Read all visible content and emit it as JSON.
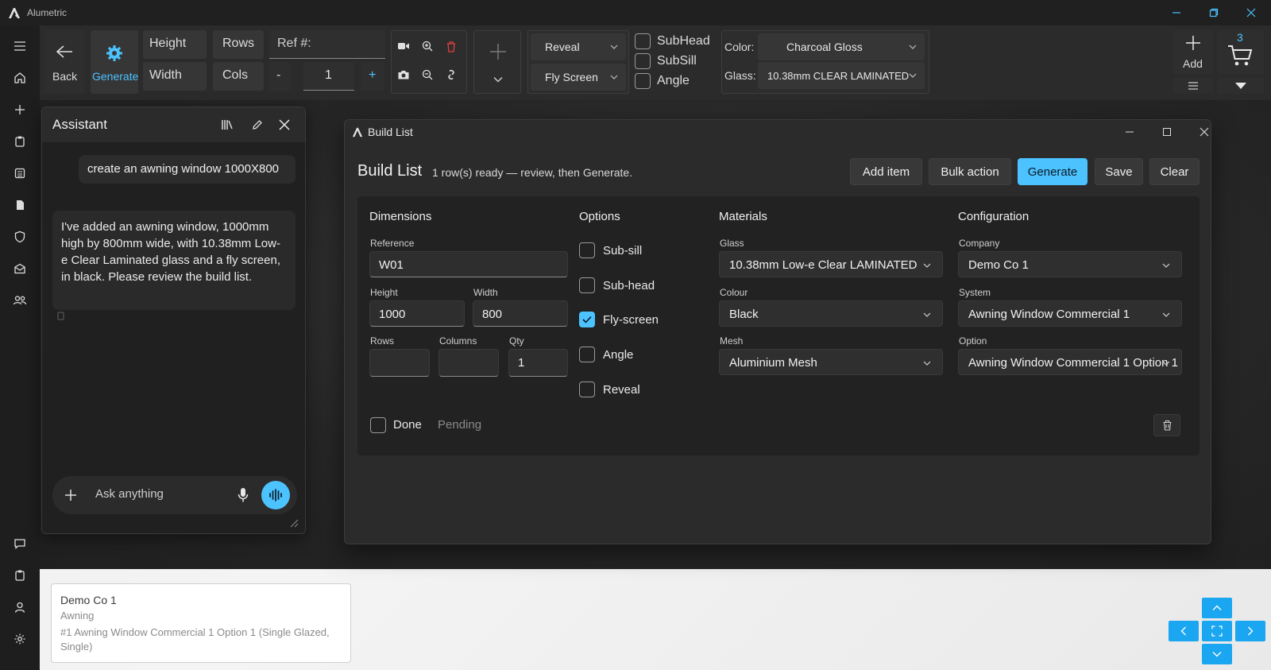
{
  "app": {
    "title": "Alumetric"
  },
  "toolbar": {
    "back_label": "Back",
    "generate_label": "Generate",
    "height_label": "Height",
    "width_label": "Width",
    "rows_label": "Rows",
    "cols_label": "Cols",
    "ref_placeholder": "Ref #:",
    "minus_label": "-",
    "plus_label": "+",
    "qty_value": "1",
    "reveal_value": "Reveal",
    "flyscreen_value": "Fly Screen",
    "subhead_label": "SubHead",
    "subsill_label": "SubSill",
    "angle_label": "Angle",
    "color_label": "Color:",
    "color_value": "Charcoal Gloss",
    "glass_label": "Glass:",
    "glass_value": "10.38mm CLEAR LAMINATED",
    "add_label": "Add",
    "cart_count": "3"
  },
  "assistant": {
    "title": "Assistant",
    "user_message": "create an awning window 1000X800",
    "bot_message": "I've added an awning window, 1000mm high by 800mm wide, with 10.38mm Low-e Clear Laminated glass and a fly screen, in black. Please review the build list.",
    "input_placeholder": "Ask anything"
  },
  "build_list": {
    "window_title": "Build List",
    "heading": "Build List",
    "status": "1 row(s) ready — review, then Generate.",
    "buttons": {
      "add_item": "Add item",
      "bulk_action": "Bulk action",
      "generate": "Generate",
      "save": "Save",
      "clear": "Clear"
    },
    "dimensions": {
      "title": "Dimensions",
      "reference_label": "Reference",
      "reference_value": "W01",
      "height_label": "Height",
      "height_value": "1000",
      "width_label": "Width",
      "width_value": "800",
      "rows_label": "Rows",
      "rows_value": "",
      "columns_label": "Columns",
      "columns_value": "",
      "qty_label": "Qty",
      "qty_value": "1"
    },
    "options": {
      "title": "Options",
      "items": [
        {
          "label": "Sub-sill",
          "checked": false
        },
        {
          "label": "Sub-head",
          "checked": false
        },
        {
          "label": "Fly-screen",
          "checked": true
        },
        {
          "label": "Angle",
          "checked": false
        },
        {
          "label": "Reveal",
          "checked": false
        }
      ]
    },
    "materials": {
      "title": "Materials",
      "glass_label": "Glass",
      "glass_value": "10.38mm Low-e Clear LAMINATED",
      "colour_label": "Colour",
      "colour_value": "Black",
      "mesh_label": "Mesh",
      "mesh_value": "Aluminium Mesh"
    },
    "configuration": {
      "title": "Configuration",
      "company_label": "Company",
      "company_value": "Demo Co 1",
      "system_label": "System",
      "system_value": "Awning Window Commercial 1",
      "option_label": "Option",
      "option_value": "Awning Window Commercial 1 Option 1"
    },
    "done_label": "Done",
    "pending_label": "Pending"
  },
  "summary": {
    "company": "Demo Co 1",
    "type": "Awning",
    "line": "#1 Awning Window Commercial 1 Option 1 (Single Glazed, Single)"
  },
  "colors": {
    "accent": "#4cc2ff",
    "nav_blue": "#1aa6f0",
    "delete_red": "#e04040"
  }
}
